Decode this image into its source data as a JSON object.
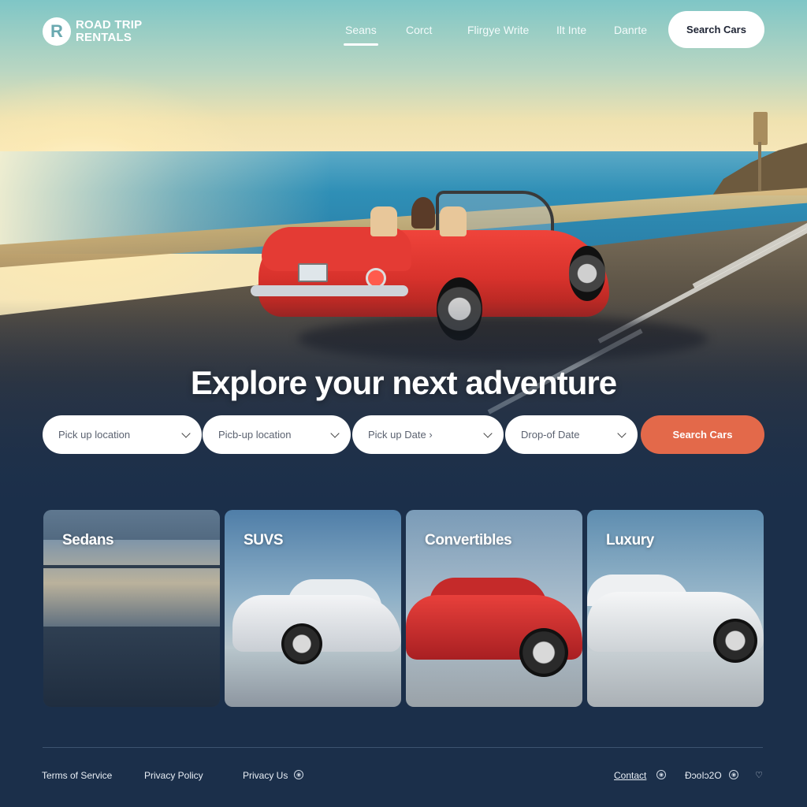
{
  "brand": {
    "logo_letter": "R",
    "line1": "ROAD TRIP",
    "line2": "RENTALS"
  },
  "nav": {
    "links": [
      "Seans",
      "Corct",
      "Flirgye  Write",
      "Ilt Inte",
      "Danrte"
    ],
    "active_index": 0,
    "cta_label": "Search Cars"
  },
  "hero": {
    "headline": "Explore your next adventure"
  },
  "search": {
    "fields": [
      {
        "label": "Pick up location"
      },
      {
        "label": "Picb-up location"
      },
      {
        "label": "Pick up Date ›"
      },
      {
        "label": "Drop-of Date"
      }
    ],
    "button_label": "Search Cars"
  },
  "categories": [
    {
      "title": "Sedans"
    },
    {
      "title": "SUVS"
    },
    {
      "title": "Convertibles"
    },
    {
      "title": "Luxury"
    }
  ],
  "footer": {
    "left_links": [
      "Terms of Service",
      "Privacy Policy",
      "Privacy Us"
    ],
    "right_links": [
      "Contact",
      "ÐɔoIɔ2O"
    ]
  },
  "colors": {
    "accent": "#e3694a",
    "background": "#1b2f4a",
    "car_red": "#e43b34"
  },
  "icons": [
    "logo-badge-icon",
    "chevron-down-icon",
    "social-circle-icon",
    "heart-icon"
  ]
}
